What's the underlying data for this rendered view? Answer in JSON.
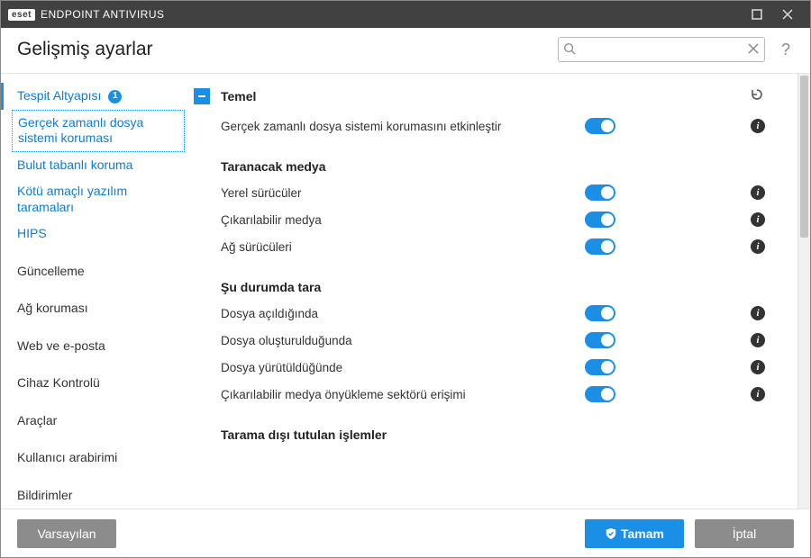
{
  "titlebar": {
    "brand": "eset",
    "product": "ENDPOINT ANTIVIRUS"
  },
  "header": {
    "title": "Gelişmiş ayarlar",
    "search_placeholder": "",
    "help": "?"
  },
  "sidebar": {
    "items": [
      {
        "label": "Tespit Altyapısı",
        "badge": "1"
      },
      {
        "label": "Gerçek zamanlı dosya sistemi koruması"
      },
      {
        "label": "Bulut tabanlı koruma"
      },
      {
        "label": "Kötü amaçlı yazılım taramaları"
      },
      {
        "label": "HIPS"
      },
      {
        "label": "Güncelleme"
      },
      {
        "label": "Ağ koruması"
      },
      {
        "label": "Web ve e-posta"
      },
      {
        "label": "Cihaz Kontrolü"
      },
      {
        "label": "Araçlar"
      },
      {
        "label": "Kullanıcı arabirimi"
      },
      {
        "label": "Bildirimler"
      }
    ]
  },
  "content": {
    "section_title": "Temel",
    "rows": {
      "enable_rt": "Gerçek zamanlı dosya sistemi korumasını etkinleştir"
    },
    "group_media": {
      "title": "Taranacak medya",
      "local": "Yerel sürücüler",
      "removable": "Çıkarılabilir medya",
      "network": "Ağ sürücüleri"
    },
    "group_scanon": {
      "title": "Şu durumda tara",
      "open": "Dosya açıldığında",
      "create": "Dosya oluşturulduğunda",
      "exec": "Dosya yürütüldüğünde",
      "bootsector": "Çıkarılabilir medya önyükleme sektörü erişimi"
    },
    "group_exclude": {
      "title": "Tarama dışı tutulan işlemler"
    }
  },
  "footer": {
    "defaults": "Varsayılan",
    "ok": "Tamam",
    "cancel": "İptal"
  }
}
